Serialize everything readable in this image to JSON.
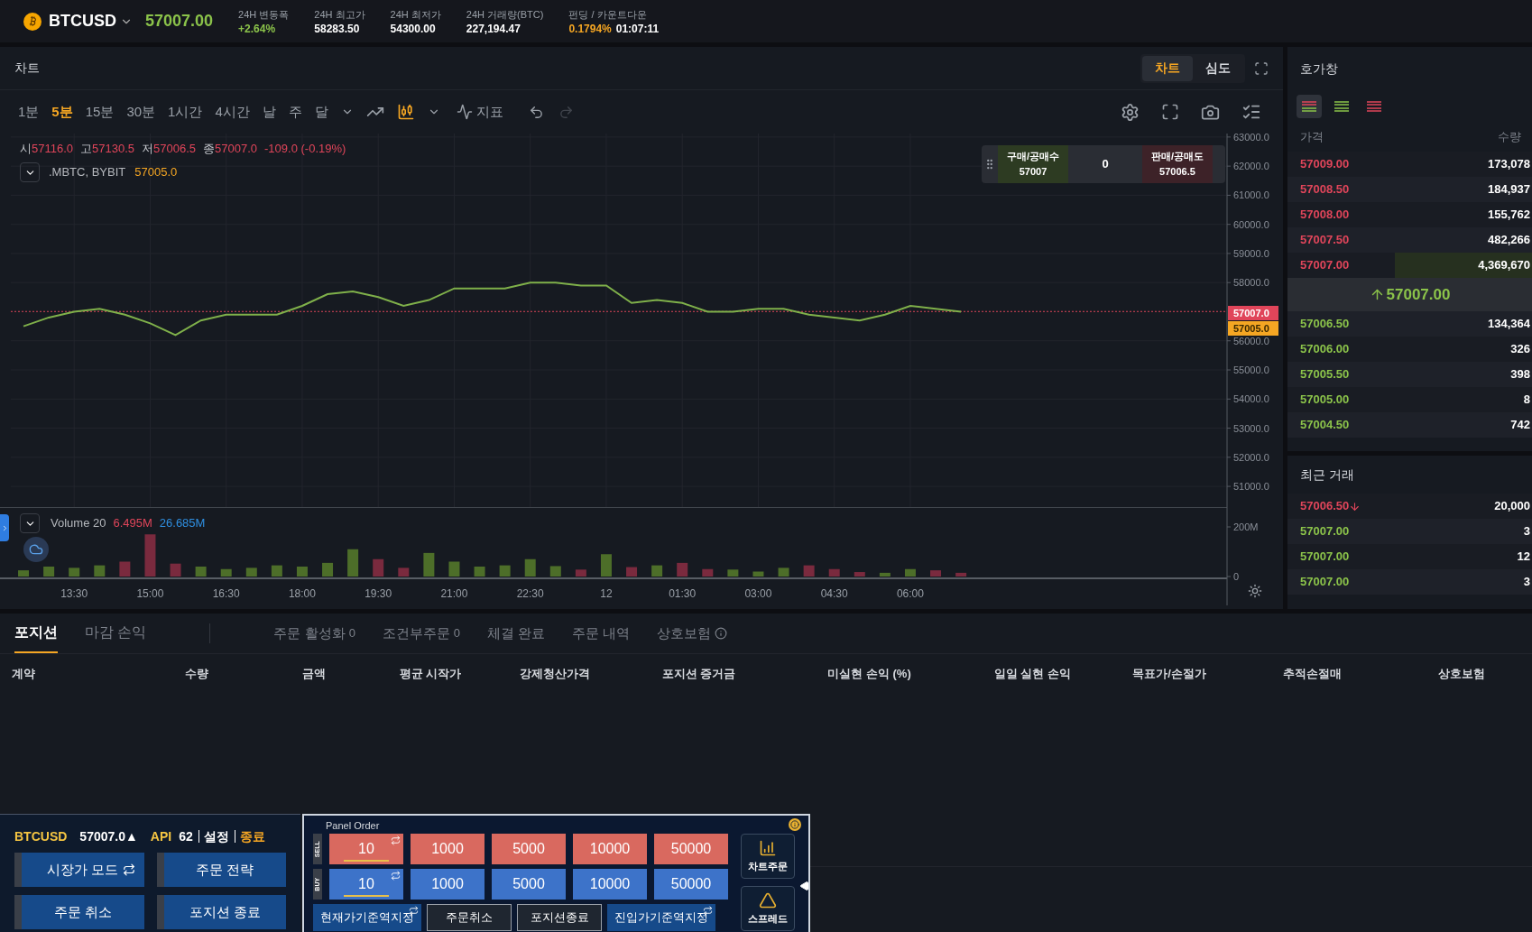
{
  "ticker": {
    "symbol": "BTCUSD",
    "price": "57007.00"
  },
  "stats": [
    {
      "label": "24H 변동폭",
      "value": "+2.64%",
      "kind": "change"
    },
    {
      "label": "24H 최고가",
      "value": "58283.50",
      "kind": "plain"
    },
    {
      "label": "24H 최저가",
      "value": "54300.00",
      "kind": "plain"
    },
    {
      "label": "24H 거래량(BTC)",
      "value": "227,194.47",
      "kind": "plain"
    }
  ],
  "funding": {
    "label": "펀딩 / 카운트다운",
    "rate": "0.1794%",
    "countdown": "01:07:11"
  },
  "chart_panel": {
    "title": "차트",
    "view_tabs": [
      {
        "label": "차트",
        "selected": true
      },
      {
        "label": "심도",
        "selected": false
      }
    ],
    "intervals": [
      {
        "label": "1분",
        "selected": false
      },
      {
        "label": "5분",
        "selected": true
      },
      {
        "label": "15분",
        "selected": false
      },
      {
        "label": "30분",
        "selected": false
      },
      {
        "label": "1시간",
        "selected": false
      },
      {
        "label": "4시간",
        "selected": false
      },
      {
        "label": "날",
        "selected": false
      },
      {
        "label": "주",
        "selected": false
      },
      {
        "label": "달",
        "selected": false
      }
    ],
    "chart_types": [
      {
        "kind": "line",
        "selected": false
      },
      {
        "kind": "candles",
        "selected": true
      }
    ],
    "indicator_label": "지표",
    "undo": {
      "disabled": false
    },
    "redo": {
      "disabled": true
    },
    "ohlc": {
      "open_label": "시",
      "open": "57116.0",
      "high_label": "고",
      "high": "57130.5",
      "low_label": "저",
      "low": "57006.5",
      "close_label": "종",
      "close": "57007.0",
      "change": "-109.0 (-0.19%)"
    },
    "compare": {
      "symbol": ".MBTC, BYBIT",
      "value": "57005.0"
    },
    "quick_trade": {
      "buy_label": "구매/공매수",
      "buy_price": "57007",
      "qty": "0",
      "sell_label": "판매/공매도",
      "sell_price": "57006.5"
    },
    "price_labels": [
      {
        "text": "57007.0",
        "kind": "last"
      },
      {
        "text": "57005.0",
        "kind": "compare"
      }
    ],
    "chart_data": {
      "type": "line",
      "categories": [
        null,
        null,
        null,
        null,
        null,
        null,
        null,
        null,
        null,
        null,
        null,
        null,
        null,
        null,
        null,
        null,
        null,
        null,
        null,
        null,
        null,
        null,
        null,
        null,
        null,
        null,
        null,
        null,
        null,
        null,
        null,
        null,
        null,
        null,
        null,
        null,
        null,
        null,
        null,
        null,
        null,
        null,
        null,
        null,
        null,
        null,
        null,
        null
      ],
      "grid": true,
      "ref_lines": [
        {
          "axis": "y",
          "value": 57007,
          "color": "#e0455a"
        }
      ],
      "series": [
        {
          "color": "#7fb04a",
          "values": [
            56500,
            56800,
            57000,
            57100,
            56900,
            56600,
            56200,
            56700,
            56900,
            56900,
            56900,
            57200,
            57600,
            57700,
            57500,
            57200,
            57400,
            57800,
            57800,
            57800,
            58000,
            58000,
            57900,
            57900,
            57300,
            57400,
            57300,
            57000,
            57000,
            57100,
            57100,
            56900,
            56800,
            56700,
            56900,
            57200,
            57100,
            57000,
            null,
            null,
            null,
            null,
            null,
            null,
            null,
            null,
            null,
            null
          ]
        }
      ],
      "ylim": [
        50290,
        63120
      ],
      "yticks": [
        {
          "value": 63000,
          "label": "63000.0"
        },
        {
          "value": 62000,
          "label": "62000.0"
        },
        {
          "value": 61000,
          "label": "61000.0"
        },
        {
          "value": 60000,
          "label": "60000.0"
        },
        {
          "value": 59000,
          "label": "59000.0"
        },
        {
          "value": 58000,
          "label": "58000.0"
        },
        {
          "value": 56000,
          "label": "56000.0"
        },
        {
          "value": 55000,
          "label": "55000.0"
        },
        {
          "value": 54000,
          "label": "54000.0"
        },
        {
          "value": 53000,
          "label": "53000.0"
        },
        {
          "value": 52000,
          "label": "52000.0"
        },
        {
          "value": 51000,
          "label": "51000.0"
        }
      ]
    },
    "volume": {
      "label": "Volume 20",
      "value_1": "6.495M",
      "value_2": "26.685M",
      "chart_data": {
        "type": "bar",
        "categories": [
          null,
          null,
          "13:30",
          null,
          null,
          "15:00",
          null,
          null,
          "16:30",
          null,
          null,
          "18:00",
          null,
          null,
          "19:30",
          null,
          null,
          "21:00",
          null,
          null,
          "22:30",
          null,
          null,
          "12",
          null,
          null,
          "01:30",
          null,
          null,
          "03:00",
          null,
          null,
          "04:30",
          null,
          null,
          "06:00",
          null,
          null,
          null,
          null,
          null,
          null,
          null,
          null,
          null,
          null,
          null,
          null
        ],
        "values": [
          25,
          40,
          35,
          45,
          60,
          170,
          52,
          40,
          30,
          35,
          45,
          40,
          55,
          110,
          70,
          35,
          95,
          60,
          40,
          45,
          70,
          42,
          28,
          90,
          38,
          45,
          55,
          30,
          28,
          20,
          35,
          45,
          30,
          18,
          15,
          30,
          25,
          15,
          null,
          null,
          null,
          null,
          null,
          null,
          null,
          null,
          null,
          null
        ],
        "ylim": [
          0,
          280
        ],
        "yticks": [
          {
            "value": 0,
            "label": "0"
          },
          {
            "value": 200,
            "label": "200M"
          }
        ]
      }
    }
  },
  "order_book": {
    "title": "호가창",
    "modes": [
      {
        "kind": "both",
        "selected": true
      },
      {
        "kind": "bids",
        "selected": false
      },
      {
        "kind": "asks",
        "selected": false
      }
    ],
    "columns": [
      "가격",
      "수량"
    ],
    "asks": [
      {
        "price": "57009.00",
        "qty": "173,078"
      },
      {
        "price": "57008.50",
        "qty": "184,937"
      },
      {
        "price": "57008.00",
        "qty": "155,762"
      },
      {
        "price": "57007.50",
        "qty": "482,266"
      },
      {
        "price": "57007.00",
        "qty": "4,369,670",
        "level": 0.56
      }
    ],
    "last_price": {
      "value": "57007.00",
      "rising": true
    },
    "bids": [
      {
        "price": "57006.50",
        "qty": "134,364"
      },
      {
        "price": "57006.00",
        "qty": "326"
      },
      {
        "price": "57005.50",
        "qty": "398"
      },
      {
        "price": "57005.00",
        "qty": "8"
      },
      {
        "price": "57004.50",
        "qty": "742"
      }
    ]
  },
  "recent_trades": {
    "title": "최근 거래",
    "rows": [
      {
        "price": "57006.50",
        "qty": "20,000",
        "kind": "sell"
      },
      {
        "price": "57007.00",
        "qty": "3",
        "kind": "buy"
      },
      {
        "price": "57007.00",
        "qty": "12",
        "kind": "buy"
      },
      {
        "price": "57007.00",
        "qty": "3",
        "kind": "buy"
      }
    ]
  },
  "positions": {
    "tabs": [
      {
        "label": "포지션",
        "selected": true
      },
      {
        "label": "마감 손익",
        "selected": false
      }
    ],
    "order_tabs": [
      {
        "label": "주문 활성화",
        "count": "0",
        "selected": false
      },
      {
        "label": "조건부주문",
        "count": "0",
        "selected": false
      },
      {
        "label": "체결 완료",
        "selected": false
      },
      {
        "label": "주문 내역",
        "selected": false
      },
      {
        "label": "상호보험",
        "info_icon": true,
        "selected": false
      }
    ],
    "columns": [
      "계약",
      "수량",
      "금액",
      "평균 시작가",
      "강제청산가격",
      "포지션 증거금",
      "미실현 손익 (%)",
      "일일 실현 손익",
      "목표가/손절가",
      "추적손절매",
      "상호보험"
    ]
  },
  "macro_panel": {
    "symbol": "BTCUSD",
    "price": "57007.0▲",
    "api_label": "API",
    "api_value": "62",
    "links": [
      {
        "label": "설정",
        "kind": "plain"
      },
      {
        "label": "종료",
        "kind": "accent"
      }
    ],
    "buttons": [
      {
        "label": "시장가 모드",
        "swap": true
      },
      {
        "label": "주문 전략",
        "swap": false
      },
      {
        "label": "주문 취소",
        "swap": false
      },
      {
        "label": "포지션 종료",
        "swap": false
      }
    ]
  },
  "panel_order": {
    "title": "Panel Order",
    "sell_label": "SELL",
    "buy_label": "BUY",
    "sell": [
      {
        "label": "10",
        "editable": true
      },
      {
        "label": "1000",
        "editable": false
      },
      {
        "label": "5000",
        "editable": false
      },
      {
        "label": "10000",
        "editable": false
      },
      {
        "label": "50000",
        "editable": false
      }
    ],
    "buy": [
      {
        "label": "10",
        "editable": true
      },
      {
        "label": "1000",
        "editable": false
      },
      {
        "label": "5000",
        "editable": false
      },
      {
        "label": "10000",
        "editable": false
      },
      {
        "label": "50000",
        "editable": false
      }
    ],
    "actions": [
      {
        "label": "현재가기준역지정",
        "kind": "primary",
        "swap": true
      },
      {
        "label": "주문취소",
        "kind": "dark",
        "swap": false
      },
      {
        "label": "포지션종료",
        "kind": "dark",
        "swap": false
      },
      {
        "label": "진입가기준역지정",
        "kind": "primary",
        "swap": true
      }
    ],
    "side_buttons": [
      {
        "label": "차트주문",
        "kind": "chart"
      },
      {
        "label": "스프레드",
        "kind": "spread"
      }
    ]
  }
}
